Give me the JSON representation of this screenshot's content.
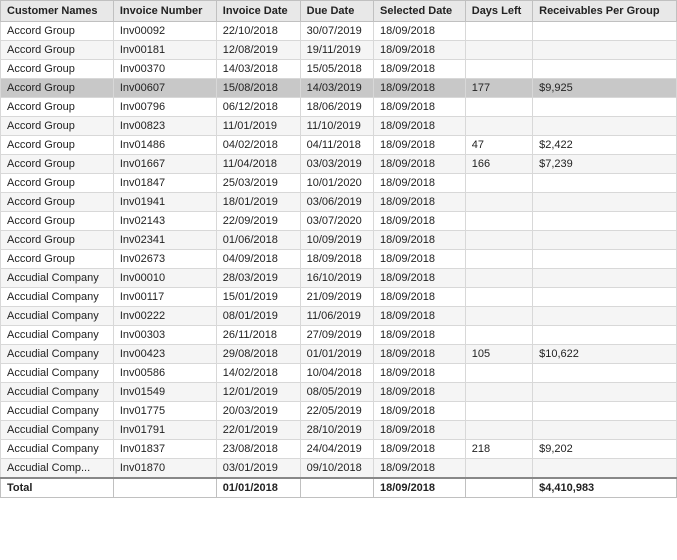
{
  "table": {
    "columns": [
      "Customer Names",
      "Invoice Number",
      "Invoice Date",
      "Due Date",
      "Selected Date",
      "Days Left",
      "Receivables Per Group"
    ],
    "rows": [
      {
        "customer": "Accord Group",
        "invoice": "Inv00092",
        "invoiceDate": "22/10/2018",
        "dueDate": "30/07/2019",
        "selectedDate": "18/09/2018",
        "daysLeft": "",
        "receivables": ""
      },
      {
        "customer": "Accord Group",
        "invoice": "Inv00181",
        "invoiceDate": "12/08/2019",
        "dueDate": "19/11/2019",
        "selectedDate": "18/09/2018",
        "daysLeft": "",
        "receivables": ""
      },
      {
        "customer": "Accord Group",
        "invoice": "Inv00370",
        "invoiceDate": "14/03/2018",
        "dueDate": "15/05/2018",
        "selectedDate": "18/09/2018",
        "daysLeft": "",
        "receivables": ""
      },
      {
        "customer": "Accord Group",
        "invoice": "Inv00607",
        "invoiceDate": "15/08/2018",
        "dueDate": "14/03/2019",
        "selectedDate": "18/09/2018",
        "daysLeft": "177",
        "receivables": "$9,925",
        "highlighted": true
      },
      {
        "customer": "Accord Group",
        "invoice": "Inv00796",
        "invoiceDate": "06/12/2018",
        "dueDate": "18/06/2019",
        "selectedDate": "18/09/2018",
        "daysLeft": "",
        "receivables": ""
      },
      {
        "customer": "Accord Group",
        "invoice": "Inv00823",
        "invoiceDate": "11/01/2019",
        "dueDate": "11/10/2019",
        "selectedDate": "18/09/2018",
        "daysLeft": "",
        "receivables": ""
      },
      {
        "customer": "Accord Group",
        "invoice": "Inv01486",
        "invoiceDate": "04/02/2018",
        "dueDate": "04/11/2018",
        "selectedDate": "18/09/2018",
        "daysLeft": "47",
        "receivables": "$2,422"
      },
      {
        "customer": "Accord Group",
        "invoice": "Inv01667",
        "invoiceDate": "11/04/2018",
        "dueDate": "03/03/2019",
        "selectedDate": "18/09/2018",
        "daysLeft": "166",
        "receivables": "$7,239"
      },
      {
        "customer": "Accord Group",
        "invoice": "Inv01847",
        "invoiceDate": "25/03/2019",
        "dueDate": "10/01/2020",
        "selectedDate": "18/09/2018",
        "daysLeft": "",
        "receivables": ""
      },
      {
        "customer": "Accord Group",
        "invoice": "Inv01941",
        "invoiceDate": "18/01/2019",
        "dueDate": "03/06/2019",
        "selectedDate": "18/09/2018",
        "daysLeft": "",
        "receivables": ""
      },
      {
        "customer": "Accord Group",
        "invoice": "Inv02143",
        "invoiceDate": "22/09/2019",
        "dueDate": "03/07/2020",
        "selectedDate": "18/09/2018",
        "daysLeft": "",
        "receivables": ""
      },
      {
        "customer": "Accord Group",
        "invoice": "Inv02341",
        "invoiceDate": "01/06/2018",
        "dueDate": "10/09/2019",
        "selectedDate": "18/09/2018",
        "daysLeft": "",
        "receivables": ""
      },
      {
        "customer": "Accord Group",
        "invoice": "Inv02673",
        "invoiceDate": "04/09/2018",
        "dueDate": "18/09/2018",
        "selectedDate": "18/09/2018",
        "daysLeft": "",
        "receivables": ""
      },
      {
        "customer": "Accudial Company",
        "invoice": "Inv00010",
        "invoiceDate": "28/03/2019",
        "dueDate": "16/10/2019",
        "selectedDate": "18/09/2018",
        "daysLeft": "",
        "receivables": ""
      },
      {
        "customer": "Accudial Company",
        "invoice": "Inv00117",
        "invoiceDate": "15/01/2019",
        "dueDate": "21/09/2019",
        "selectedDate": "18/09/2018",
        "daysLeft": "",
        "receivables": ""
      },
      {
        "customer": "Accudial Company",
        "invoice": "Inv00222",
        "invoiceDate": "08/01/2019",
        "dueDate": "11/06/2019",
        "selectedDate": "18/09/2018",
        "daysLeft": "",
        "receivables": ""
      },
      {
        "customer": "Accudial Company",
        "invoice": "Inv00303",
        "invoiceDate": "26/11/2018",
        "dueDate": "27/09/2019",
        "selectedDate": "18/09/2018",
        "daysLeft": "",
        "receivables": ""
      },
      {
        "customer": "Accudial Company",
        "invoice": "Inv00423",
        "invoiceDate": "29/08/2018",
        "dueDate": "01/01/2019",
        "selectedDate": "18/09/2018",
        "daysLeft": "105",
        "receivables": "$10,622"
      },
      {
        "customer": "Accudial Company",
        "invoice": "Inv00586",
        "invoiceDate": "14/02/2018",
        "dueDate": "10/04/2018",
        "selectedDate": "18/09/2018",
        "daysLeft": "",
        "receivables": ""
      },
      {
        "customer": "Accudial Company",
        "invoice": "Inv01549",
        "invoiceDate": "12/01/2019",
        "dueDate": "08/05/2019",
        "selectedDate": "18/09/2018",
        "daysLeft": "",
        "receivables": ""
      },
      {
        "customer": "Accudial Company",
        "invoice": "Inv01775",
        "invoiceDate": "20/03/2019",
        "dueDate": "22/05/2019",
        "selectedDate": "18/09/2018",
        "daysLeft": "",
        "receivables": ""
      },
      {
        "customer": "Accudial Company",
        "invoice": "Inv01791",
        "invoiceDate": "22/01/2019",
        "dueDate": "28/10/2019",
        "selectedDate": "18/09/2018",
        "daysLeft": "",
        "receivables": ""
      },
      {
        "customer": "Accudial Company",
        "invoice": "Inv01837",
        "invoiceDate": "23/08/2018",
        "dueDate": "24/04/2019",
        "selectedDate": "18/09/2018",
        "daysLeft": "218",
        "receivables": "$9,202"
      },
      {
        "customer": "Accudial Comp...",
        "invoice": "Inv01870",
        "invoiceDate": "03/01/2019",
        "dueDate": "09/10/2018",
        "selectedDate": "18/09/2018",
        "daysLeft": "",
        "receivables": ""
      }
    ],
    "footer": {
      "label": "Total",
      "invoiceDate": "01/01/2018",
      "selectedDate": "18/09/2018",
      "receivables": "$4,410,983"
    }
  }
}
